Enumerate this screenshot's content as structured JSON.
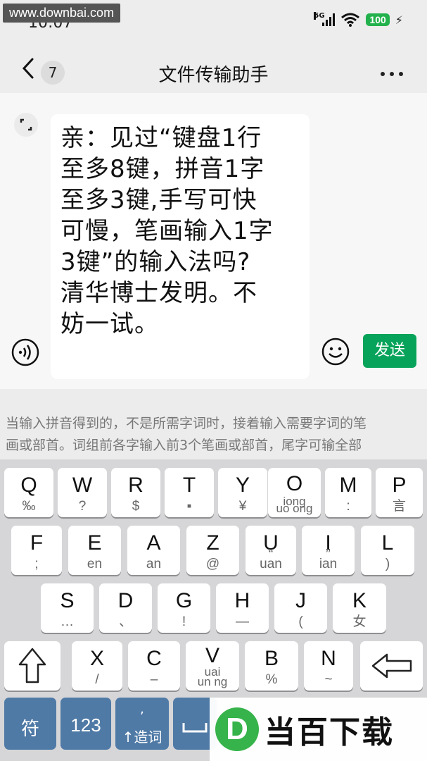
{
  "status_bar": {
    "time": "10:07",
    "watermark_url": "www.downbai.com",
    "network_label": "5G",
    "battery_level": "100"
  },
  "nav": {
    "unread_count": "7",
    "title": "文件传输助手"
  },
  "composer": {
    "text_lines": [
      "亲：见过“键盘1行",
      "至多8键，拼音1字",
      "至多3键,手写可快",
      "可慢，笔画输入1字",
      "3键”的输入法吗?",
      "清华博士发明。不",
      "妨一试。"
    ],
    "send_label": "发送"
  },
  "ime_hint": {
    "lines": [
      "当输入拼音得到的，不是所需字词时，接着输入需要字词的笔",
      "画或部首。词组前各字输入前3个笔画或部首，尾字可输全部"
    ]
  },
  "keyboard": {
    "row1": [
      {
        "main": "Q",
        "sub": "‰"
      },
      {
        "main": "W",
        "sub": "?"
      },
      {
        "main": "R",
        "sub": "$"
      },
      {
        "main": "T",
        "sub": "▪"
      },
      {
        "main": "Y",
        "sub": "¥"
      },
      {
        "main": "O",
        "mid": "iong",
        "sub": "uo ong"
      },
      {
        "main": "M",
        "sub": ":"
      },
      {
        "main": "P",
        "sub": "言"
      }
    ],
    "row2": [
      {
        "main": "F",
        "sub": ";"
      },
      {
        "main": "E",
        "sub": "en"
      },
      {
        "main": "A",
        "sub": "an"
      },
      {
        "main": "Z",
        "sub": "@"
      },
      {
        "main": "U",
        "mid": "“",
        "sub": "uan"
      },
      {
        "main": "I",
        "mid": "”",
        "sub": "ian"
      },
      {
        "main": "L",
        "sub": ")"
      }
    ],
    "row3": [
      {
        "main": "S",
        "sub": "…"
      },
      {
        "main": "D",
        "sub": "、"
      },
      {
        "main": "G",
        "sub": "!"
      },
      {
        "main": "H",
        "sub": "—"
      },
      {
        "main": "J",
        "sub": "("
      },
      {
        "main": "K",
        "sub": "女"
      }
    ],
    "row4": [
      {
        "main": "X",
        "sub": "/"
      },
      {
        "main": "C",
        "sub": "–"
      },
      {
        "main": "V",
        "mid": "uai",
        "sub": "un ng"
      },
      {
        "main": "B",
        "sub": "%"
      },
      {
        "main": "N",
        "sub": "~"
      }
    ],
    "bottom": {
      "symbols_label": "符",
      "numbers_label": "123",
      "phrase_tick": ",",
      "phrase_label": "↑造词"
    }
  },
  "overlay_brand": {
    "logo_letter": "D",
    "text": "当百下载"
  },
  "colors": {
    "send_button": "#07a35a",
    "function_keys": "#4f7aa6",
    "battery": "#22b14c"
  }
}
